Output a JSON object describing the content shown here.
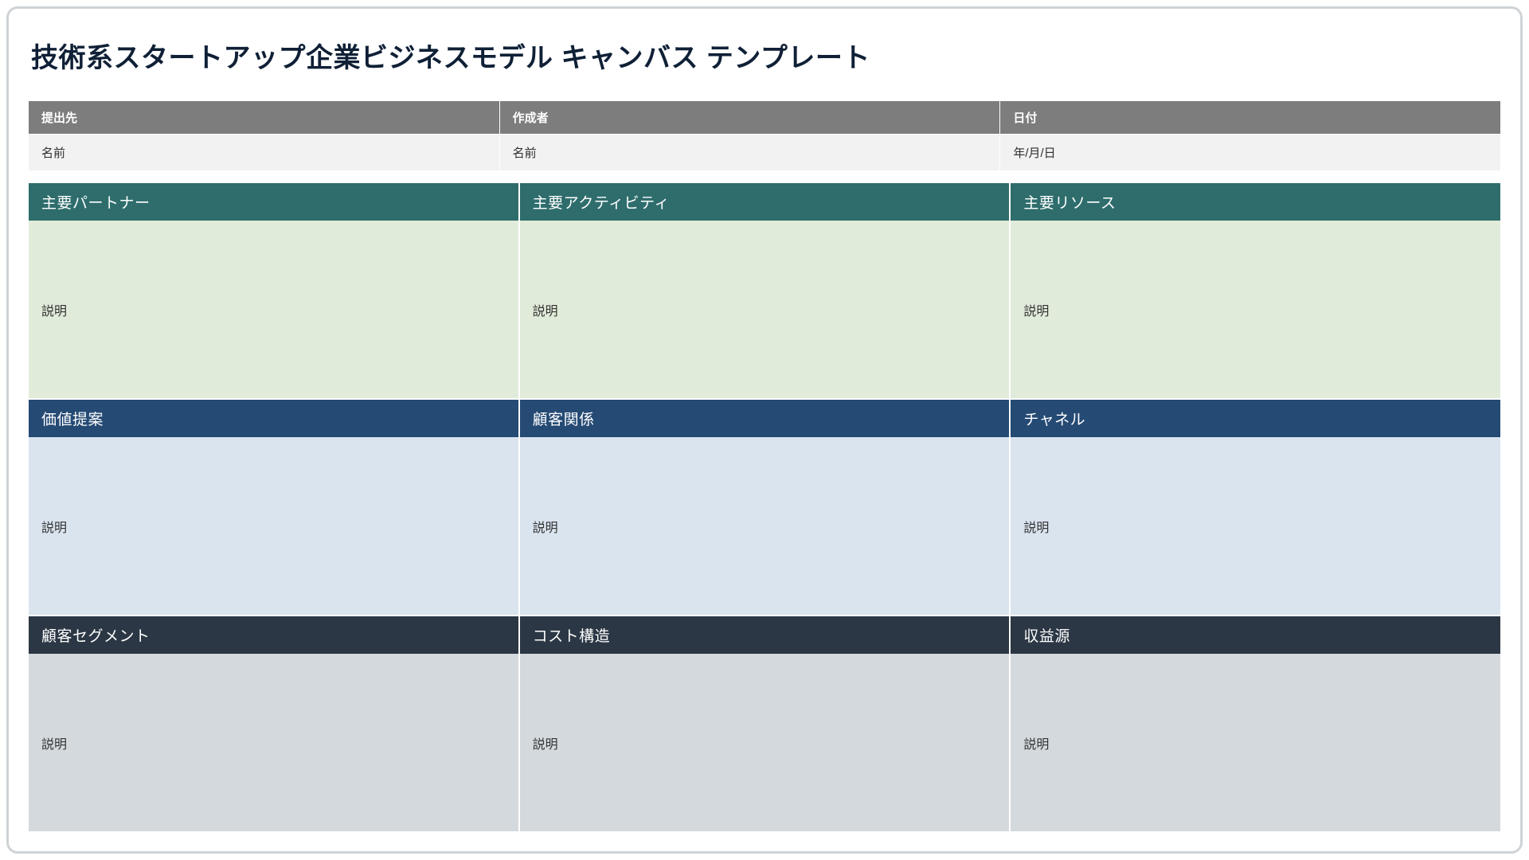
{
  "title": "技術系スタートアップ企業ビジネスモデル キャンバス テンプレート",
  "meta": {
    "headers": {
      "submitted_to": "提出先",
      "created_by": "作成者",
      "date": "日付"
    },
    "placeholders": {
      "submitted_to": "名前",
      "created_by": "名前",
      "date": "年/月/日"
    }
  },
  "canvas": {
    "row1": {
      "c1": {
        "header": "主要パートナー",
        "body": "説明"
      },
      "c2": {
        "header": "主要アクティビティ",
        "body": "説明"
      },
      "c3": {
        "header": "主要リソース",
        "body": "説明"
      }
    },
    "row2": {
      "c1": {
        "header": "価値提案",
        "body": "説明"
      },
      "c2": {
        "header": "顧客関係",
        "body": "説明"
      },
      "c3": {
        "header": "チャネル",
        "body": "説明"
      }
    },
    "row3": {
      "c1": {
        "header": "顧客セグメント",
        "body": "説明"
      },
      "c2": {
        "header": "コスト構造",
        "body": "説明"
      },
      "c3": {
        "header": "収益源",
        "body": "説明"
      }
    }
  }
}
